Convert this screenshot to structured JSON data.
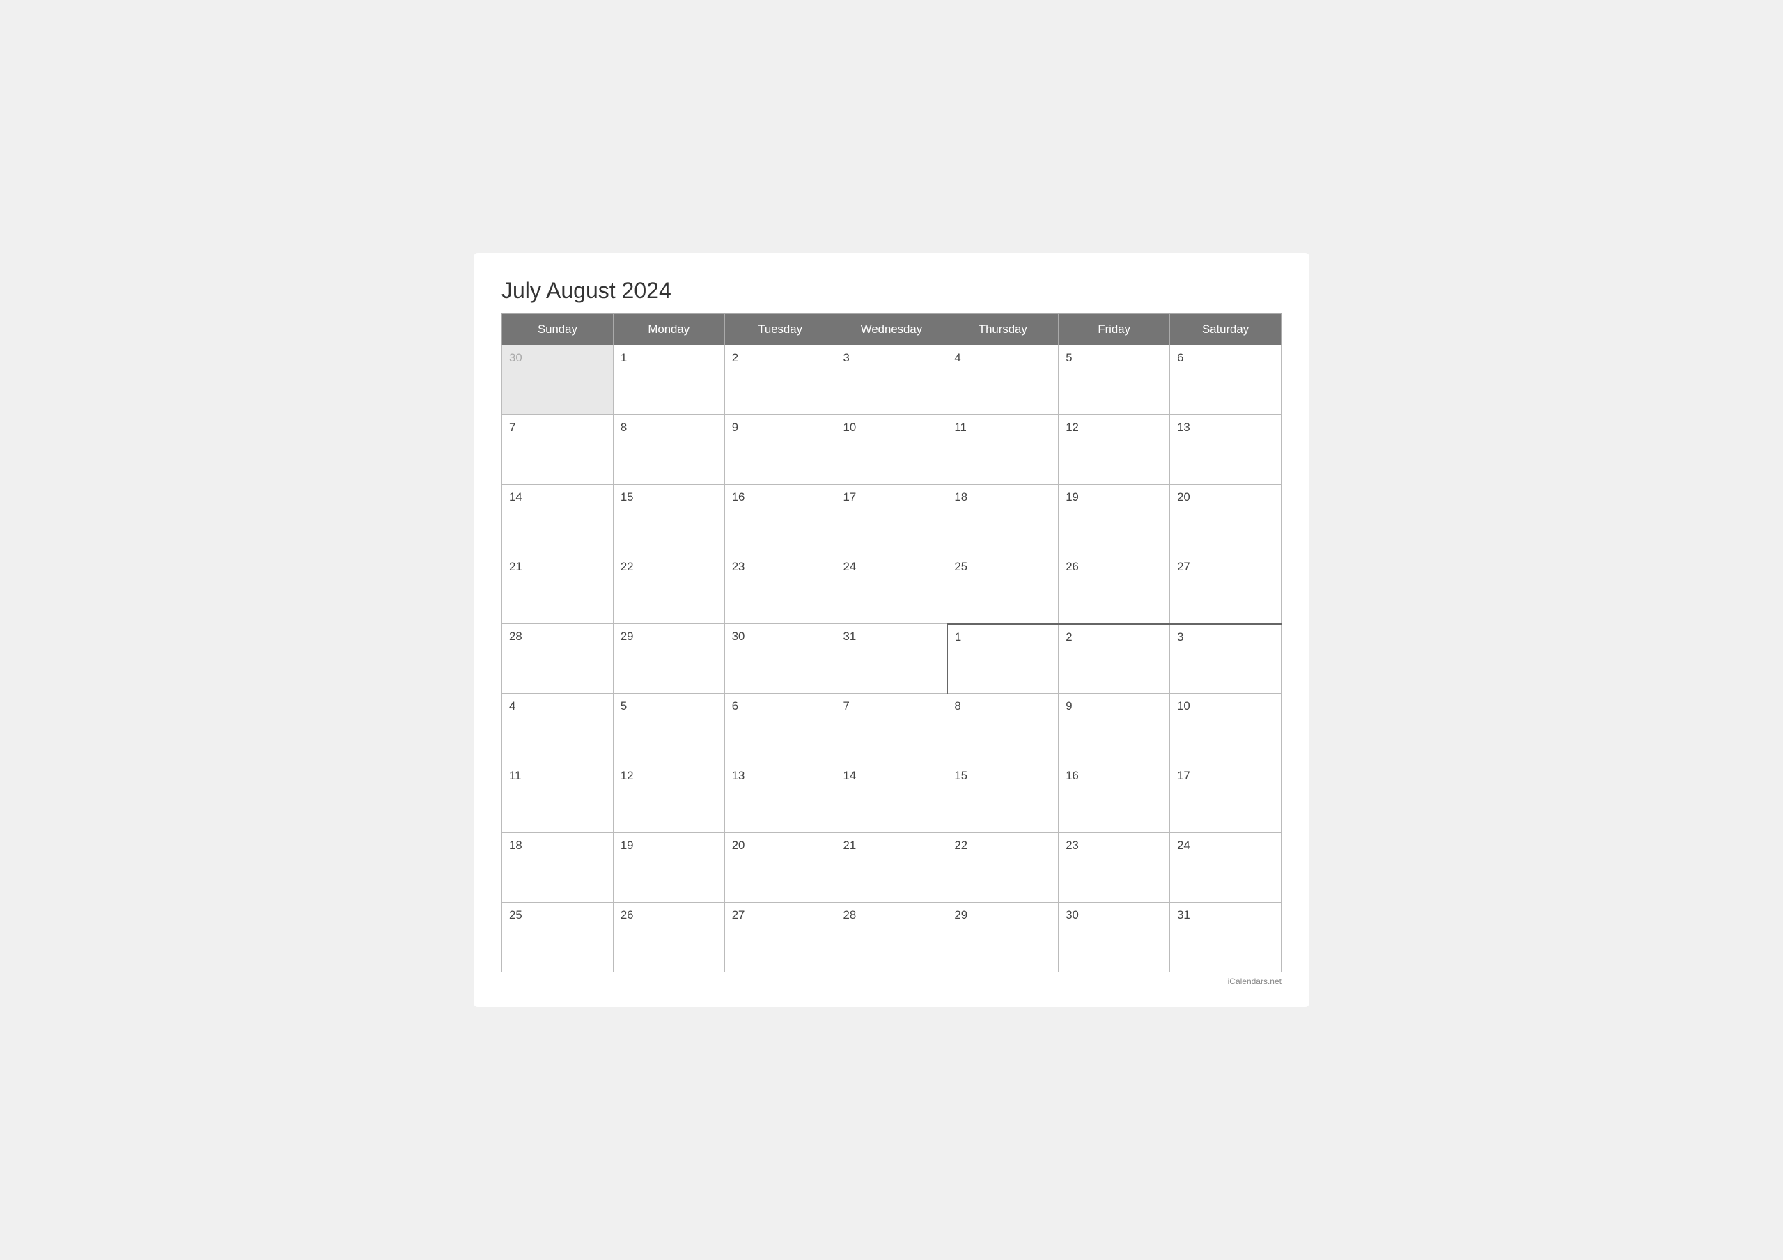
{
  "calendar": {
    "title": "July August 2024",
    "days_of_week": [
      "Sunday",
      "Monday",
      "Tuesday",
      "Wednesday",
      "Thursday",
      "Friday",
      "Saturday"
    ],
    "rows": [
      [
        {
          "day": "30",
          "type": "prev-month"
        },
        {
          "day": "1",
          "type": "current"
        },
        {
          "day": "2",
          "type": "current"
        },
        {
          "day": "3",
          "type": "current"
        },
        {
          "day": "4",
          "type": "current"
        },
        {
          "day": "5",
          "type": "current"
        },
        {
          "day": "6",
          "type": "current"
        }
      ],
      [
        {
          "day": "7",
          "type": "current"
        },
        {
          "day": "8",
          "type": "current"
        },
        {
          "day": "9",
          "type": "current"
        },
        {
          "day": "10",
          "type": "current"
        },
        {
          "day": "11",
          "type": "current"
        },
        {
          "day": "12",
          "type": "current"
        },
        {
          "day": "13",
          "type": "current"
        }
      ],
      [
        {
          "day": "14",
          "type": "current"
        },
        {
          "day": "15",
          "type": "current"
        },
        {
          "day": "16",
          "type": "current"
        },
        {
          "day": "17",
          "type": "current"
        },
        {
          "day": "18",
          "type": "current"
        },
        {
          "day": "19",
          "type": "current"
        },
        {
          "day": "20",
          "type": "current"
        }
      ],
      [
        {
          "day": "21",
          "type": "current"
        },
        {
          "day": "22",
          "type": "current"
        },
        {
          "day": "23",
          "type": "current"
        },
        {
          "day": "24",
          "type": "current"
        },
        {
          "day": "25",
          "type": "current"
        },
        {
          "day": "26",
          "type": "current"
        },
        {
          "day": "27",
          "type": "current"
        }
      ],
      [
        {
          "day": "28",
          "type": "current"
        },
        {
          "day": "29",
          "type": "current"
        },
        {
          "day": "30",
          "type": "current"
        },
        {
          "day": "31",
          "type": "current"
        },
        {
          "day": "1",
          "type": "next-month month-boundary-top month-boundary-left"
        },
        {
          "day": "2",
          "type": "next-month month-boundary-top"
        },
        {
          "day": "3",
          "type": "next-month month-boundary-top"
        }
      ],
      [
        {
          "day": "4",
          "type": "next-month"
        },
        {
          "day": "5",
          "type": "next-month"
        },
        {
          "day": "6",
          "type": "next-month"
        },
        {
          "day": "7",
          "type": "next-month"
        },
        {
          "day": "8",
          "type": "next-month"
        },
        {
          "day": "9",
          "type": "next-month"
        },
        {
          "day": "10",
          "type": "next-month"
        }
      ],
      [
        {
          "day": "11",
          "type": "next-month"
        },
        {
          "day": "12",
          "type": "next-month"
        },
        {
          "day": "13",
          "type": "next-month"
        },
        {
          "day": "14",
          "type": "next-month"
        },
        {
          "day": "15",
          "type": "next-month"
        },
        {
          "day": "16",
          "type": "next-month"
        },
        {
          "day": "17",
          "type": "next-month"
        }
      ],
      [
        {
          "day": "18",
          "type": "next-month"
        },
        {
          "day": "19",
          "type": "next-month"
        },
        {
          "day": "20",
          "type": "next-month"
        },
        {
          "day": "21",
          "type": "next-month"
        },
        {
          "day": "22",
          "type": "next-month"
        },
        {
          "day": "23",
          "type": "next-month"
        },
        {
          "day": "24",
          "type": "next-month"
        }
      ],
      [
        {
          "day": "25",
          "type": "next-month"
        },
        {
          "day": "26",
          "type": "next-month"
        },
        {
          "day": "27",
          "type": "next-month"
        },
        {
          "day": "28",
          "type": "next-month"
        },
        {
          "day": "29",
          "type": "next-month"
        },
        {
          "day": "30",
          "type": "next-month"
        },
        {
          "day": "31",
          "type": "next-month"
        }
      ]
    ],
    "footer": "iCalendars.net"
  }
}
